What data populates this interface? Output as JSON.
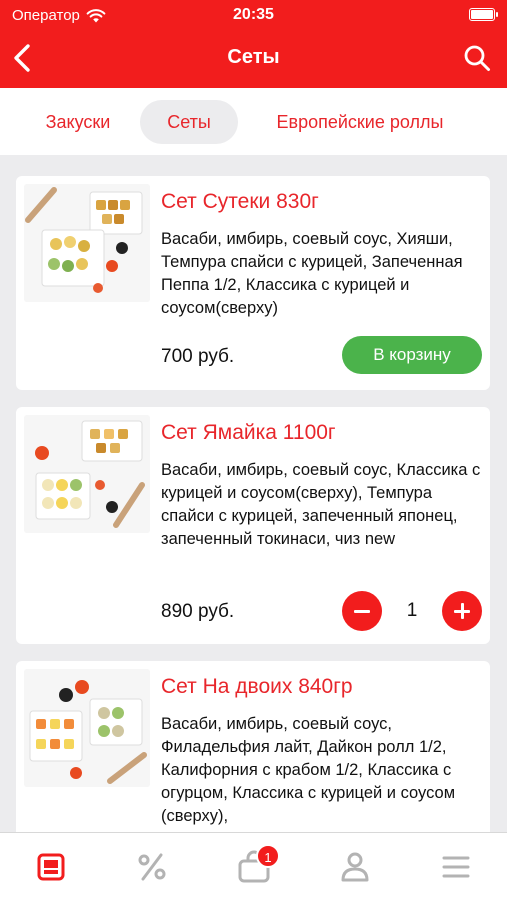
{
  "status_bar": {
    "carrier": "Оператор",
    "time": "20:35"
  },
  "header": {
    "title": "Сеты",
    "back_icon": "chevron-left-icon",
    "search_icon": "search-icon"
  },
  "tabs": [
    {
      "label": "Закуски",
      "active": false
    },
    {
      "label": "Сеты",
      "active": true
    },
    {
      "label": "Европейские роллы",
      "active": false
    }
  ],
  "products": [
    {
      "name": "Сет Сутеки 830г",
      "description": "Васаби, имбирь, соевый соус, Хияши, Темпура спайси с курицей, Запеченная Пеппа 1/2, Классика с курицей и соусом(сверху)",
      "price": "700 руб.",
      "action": "В корзину"
    },
    {
      "name": "Сет Ямайка 1100г",
      "description": "Васаби, имбирь, соевый соус, Классика с курицей и соусом(сверху), Темпура спайси с курицей, запеченный японец, запеченный токинаси, чиз new",
      "price": "890 руб.",
      "quantity": "1"
    },
    {
      "name": "Сет На двоих 840гр",
      "description": "Васаби, имбирь, соевый соус, Филадельфия лайт, Дайкон ролл 1/2, Калифорния с крабом 1/2, Классика с огурцом, Классика с курицей и соусом (сверху),"
    }
  ],
  "bottom_nav": {
    "items": [
      "menu-icon",
      "discount-icon",
      "cart-icon",
      "profile-icon",
      "more-icon"
    ],
    "cart_badge": "1"
  },
  "colors": {
    "brand": "#f21d1d",
    "accent_text": "#e8262b",
    "cart_button": "#4bb34b",
    "background": "#ececee"
  }
}
